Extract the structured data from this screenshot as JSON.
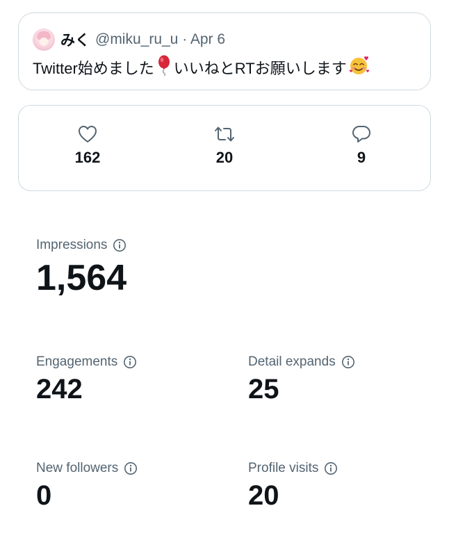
{
  "tweet": {
    "display_name": "みく",
    "handle_date": "@miku_ru_u · Apr 6",
    "text_before": "Twitter始めました",
    "text_after": "いいねとRTお願いします",
    "emoji_balloon": "balloon-icon",
    "emoji_smile": "smiling-face-with-hearts-icon"
  },
  "actions": {
    "likes": "162",
    "retweets": "20",
    "replies": "9"
  },
  "metrics": {
    "impressions": {
      "label": "Impressions",
      "value": "1,564"
    },
    "engagements": {
      "label": "Engagements",
      "value": "242"
    },
    "detail_expands": {
      "label": "Detail expands",
      "value": "25"
    },
    "new_followers": {
      "label": "New followers",
      "value": "0"
    },
    "profile_visits": {
      "label": "Profile visits",
      "value": "20"
    }
  },
  "colors": {
    "text": "#0f1419",
    "secondary": "#536471",
    "border": "#cfd9de"
  }
}
